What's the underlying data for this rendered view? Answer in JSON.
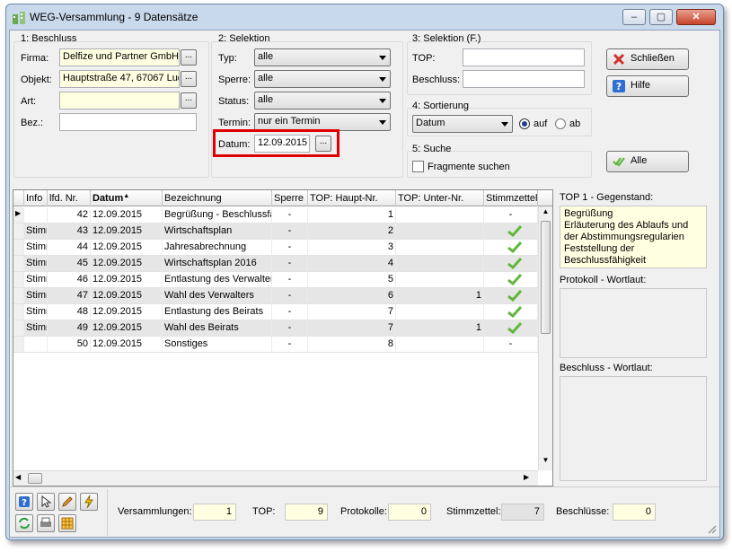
{
  "window": {
    "title": "WEG-Versammlung - 9 Datensätze",
    "min": "–",
    "max": "▢",
    "close": "✕"
  },
  "beschluss": {
    "group_label": "1: Beschluss",
    "firma_label": "Firma:",
    "firma_value": "Delfize und Partner GmbH",
    "objekt_label": "Objekt:",
    "objekt_value": "Hauptstraße 47, 67067 Lud",
    "art_label": "Art:",
    "art_value": "",
    "bez_label": "Bez.:",
    "bez_value": "",
    "dots": "..."
  },
  "selektion": {
    "group_label": "2: Selektion",
    "typ_label": "Typ:",
    "typ_value": "alle",
    "sperre_label": "Sperre:",
    "sperre_value": "alle",
    "status_label": "Status:",
    "status_value": "alle",
    "termin_label": "Termin:",
    "termin_value": "nur ein Termin",
    "datum_label": "Datum:",
    "datum_value": "12.09.2015"
  },
  "selektion_f": {
    "group_label": "3: Selektion (F.)",
    "top_label": "TOP:",
    "top_value": "",
    "beschluss_label": "Beschluss:",
    "beschluss_value": ""
  },
  "sortierung": {
    "group_label": "4: Sortierung",
    "value": "Datum",
    "auf_label": "auf",
    "ab_label": "ab"
  },
  "suche": {
    "group_label": "5: Suche",
    "fragmente_label": "Fragmente suchen"
  },
  "buttons": {
    "schliessen": "Schließen",
    "hilfe": "Hilfe",
    "alle": "Alle"
  },
  "grid": {
    "headers": [
      "Info",
      "lfd. Nr.",
      "Datum",
      "Bezeichnung",
      "Sperre",
      "TOP: Haupt-Nr.",
      "TOP: Unter-Nr.",
      "Stimmzettel"
    ],
    "rows": [
      {
        "info": "",
        "nr": "42",
        "datum": "12.09.2015",
        "bez": "Begrüßung - Beschlussfä",
        "sperre": "-",
        "haupt": "1",
        "unter": "",
        "stimm": "-"
      },
      {
        "info": "Stimr",
        "nr": "43",
        "datum": "12.09.2015",
        "bez": "Wirtschaftsplan",
        "sperre": "-",
        "haupt": "2",
        "unter": "",
        "stimm": "check"
      },
      {
        "info": "Stimr",
        "nr": "44",
        "datum": "12.09.2015",
        "bez": "Jahresabrechnung",
        "sperre": "-",
        "haupt": "3",
        "unter": "",
        "stimm": "check"
      },
      {
        "info": "Stimr",
        "nr": "45",
        "datum": "12.09.2015",
        "bez": "Wirtschaftsplan 2016",
        "sperre": "-",
        "haupt": "4",
        "unter": "",
        "stimm": "check"
      },
      {
        "info": "Stimr",
        "nr": "46",
        "datum": "12.09.2015",
        "bez": "Entlastung des Verwalter",
        "sperre": "-",
        "haupt": "5",
        "unter": "",
        "stimm": "check"
      },
      {
        "info": "Stimr",
        "nr": "47",
        "datum": "12.09.2015",
        "bez": "Wahl des Verwalters",
        "sperre": "-",
        "haupt": "6",
        "unter": "1",
        "stimm": "check"
      },
      {
        "info": "Stimr",
        "nr": "48",
        "datum": "12.09.2015",
        "bez": "Entlastung des Beirats",
        "sperre": "-",
        "haupt": "7",
        "unter": "",
        "stimm": "check"
      },
      {
        "info": "Stimr",
        "nr": "49",
        "datum": "12.09.2015",
        "bez": "Wahl des Beirats",
        "sperre": "-",
        "haupt": "7",
        "unter": "1",
        "stimm": "check"
      },
      {
        "info": "",
        "nr": "50",
        "datum": "12.09.2015",
        "bez": "Sonstiges",
        "sperre": "-",
        "haupt": "8",
        "unter": "",
        "stimm": "-"
      }
    ]
  },
  "side": {
    "gegenstand_label": "TOP 1 - Gegenstand:",
    "gegenstand_text": "Begrüßung\nErläuterung des Ablaufs und der Abstimmungsregularien\nFeststellung der Beschlussfähigkeit",
    "protokoll_label": "Protokoll - Wortlaut:",
    "beschluss_label": "Beschluss - Wortlaut:"
  },
  "status": {
    "versammlungen_label": "Versammlungen:",
    "versammlungen": "1",
    "top_label": "TOP:",
    "top": "9",
    "protokolle_label": "Protokolle:",
    "protokolle": "0",
    "stimmzettel_label": "Stimmzettel:",
    "stimmzettel": "7",
    "beschluesse_label": "Beschlüsse:",
    "beschluesse": "0"
  },
  "colors": {
    "accent_red": "#e00000",
    "check_green": "#5fb83a",
    "yellow_field": "#ffffe1",
    "selected_row": "#e6e6e6"
  }
}
